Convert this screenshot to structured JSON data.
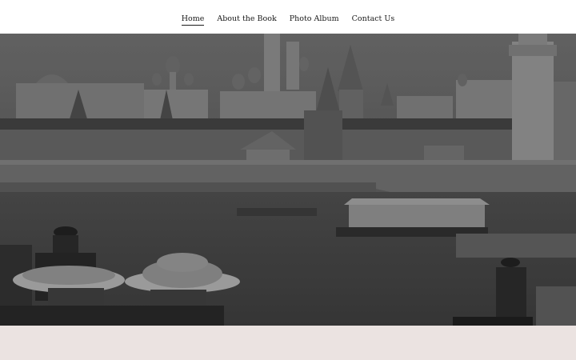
{
  "nav": {
    "items": [
      {
        "label": "Home",
        "active": true
      },
      {
        "label": "About the Book",
        "active": false
      },
      {
        "label": "Photo Album",
        "active": false
      },
      {
        "label": "Contact Us",
        "active": false
      }
    ]
  },
  "hero": {
    "subject": "Kremlin river view",
    "tone": "grayscale"
  },
  "colors": {
    "nav_bg": "#ffffff",
    "nav_text": "#1a1a1a",
    "footer_band": "#ebe3e1"
  }
}
